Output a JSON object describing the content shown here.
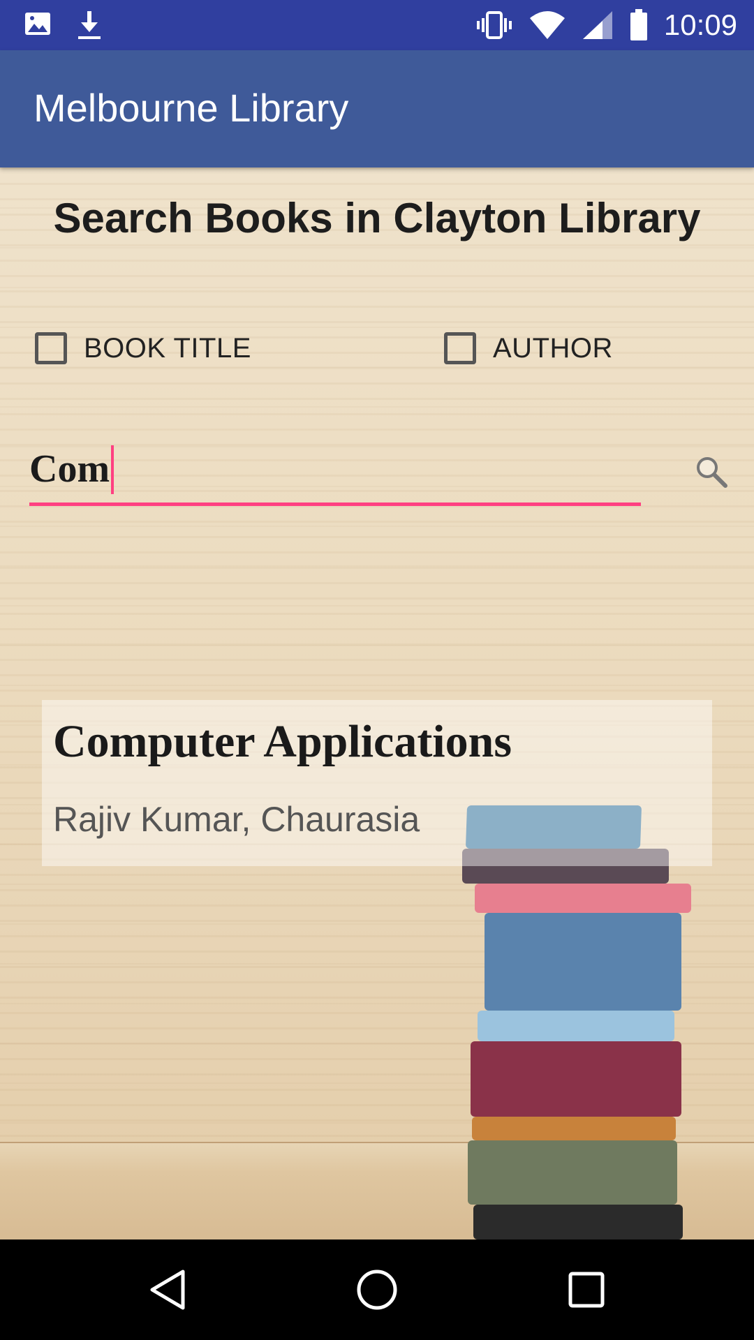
{
  "status_bar": {
    "time": "10:09",
    "left_icons": [
      "image-icon",
      "download-icon"
    ],
    "right_icons": [
      "vibrate-icon",
      "wifi-icon",
      "signal-icon",
      "battery-icon"
    ]
  },
  "app_bar": {
    "title": "Melbourne Library",
    "color": "#3f5a99"
  },
  "main": {
    "heading": "Search Books in Clayton Library",
    "filters": [
      {
        "label": "BOOK TITLE",
        "checked": false
      },
      {
        "label": "AUTHOR",
        "checked": false
      }
    ],
    "search": {
      "value": "Com",
      "icon": "search-icon",
      "accent_color": "#ff4081"
    },
    "results": [
      {
        "title": "Computer Applications",
        "author": "Rajiv Kumar, Chaurasia"
      }
    ]
  },
  "nav_bar": {
    "buttons": [
      "back-icon",
      "home-icon",
      "recents-icon"
    ]
  }
}
